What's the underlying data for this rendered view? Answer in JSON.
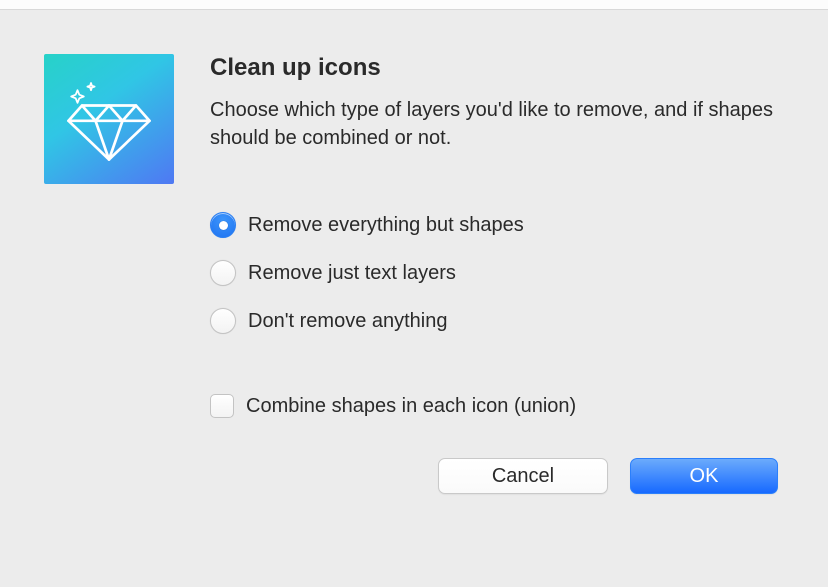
{
  "header": {
    "title": "Clean up icons",
    "description": "Choose which type of layers you'd like to remove, and if shapes should be combined or not."
  },
  "radios": {
    "option1": {
      "label": "Remove everything but shapes",
      "selected": true
    },
    "option2": {
      "label": "Remove just text layers",
      "selected": false
    },
    "option3": {
      "label": "Don't remove anything",
      "selected": false
    }
  },
  "checkbox": {
    "combine": {
      "label": "Combine shapes in each icon (union)",
      "checked": false
    }
  },
  "buttons": {
    "cancel": "Cancel",
    "ok": "OK"
  },
  "icon": {
    "name": "diamond-icon"
  }
}
